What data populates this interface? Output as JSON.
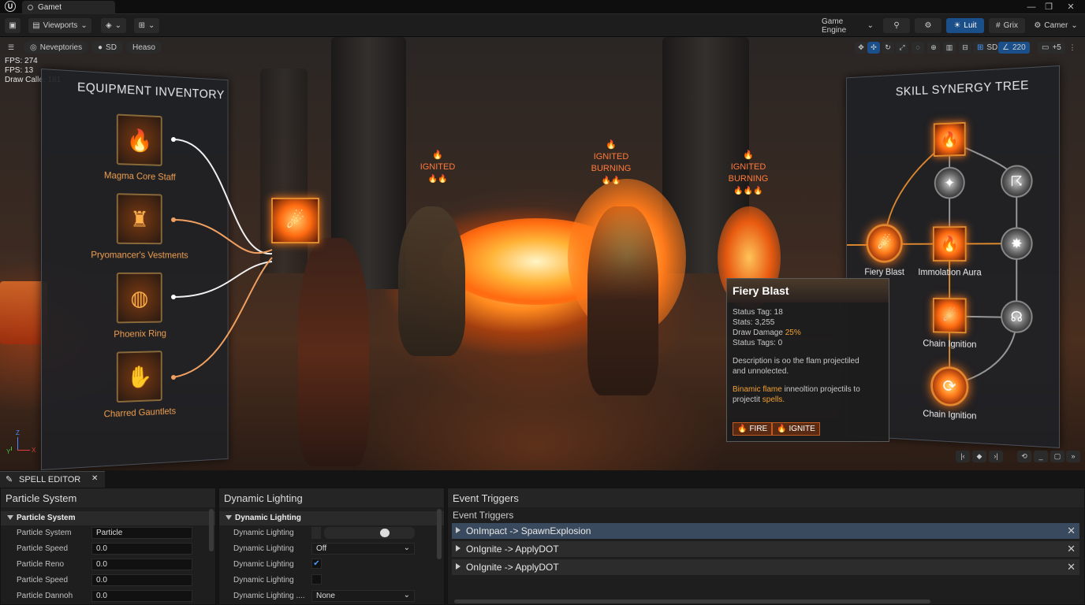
{
  "app": {
    "logo": "U",
    "tab_title": "Gamet",
    "win_min": "—",
    "win_max": "❐",
    "win_close": "✕"
  },
  "toolbar": {
    "viewports_label": "Viewports",
    "game_engine_label": "Game Engine",
    "lit_label": "Luit",
    "grid_label": "Grix",
    "camera_label": "Camer"
  },
  "viewport_bar": {
    "chip1": "Neveptories",
    "chip2": "SD",
    "chip3": "Heaso",
    "sd_right": "SD",
    "num": "220",
    "cam_speed": "+5"
  },
  "stats": {
    "fps1": "FPS: 274",
    "fps2": "FPS: 13",
    "draw_calls": "Draw Calle: 181"
  },
  "inventory": {
    "title": "EQUIPMENT INVENTORY",
    "items": [
      {
        "name": "Magma Core Staff",
        "icon": "staff-icon",
        "glyph": "🔥"
      },
      {
        "name": "Pryomancer's Vestments",
        "icon": "armor-icon",
        "glyph": "♜"
      },
      {
        "name": "Phoenix Ring",
        "icon": "ring-icon",
        "glyph": "◍"
      },
      {
        "name": "Charred Gauntlets",
        "icon": "gauntlet-icon",
        "glyph": "✋"
      }
    ]
  },
  "enemy_tags": [
    {
      "line1": "IGNITED",
      "line2": ""
    },
    {
      "line1": "IGNITED",
      "line2": "BURNING"
    },
    {
      "line1": "IGNITED",
      "line2": "BURNING"
    }
  ],
  "skill_tree": {
    "title": "SKILL SYNERGY TREE",
    "fiery_blast": "Fiery Blast",
    "immolation_aura": "Immolation Aura",
    "chain_ignition_1": "Chain Ignition",
    "chain_ignition_2": "Chain Ignition"
  },
  "tooltip": {
    "title": "Fiery Blast",
    "status_tag": "Status Tag: 18",
    "stats": "Stats: 3,255",
    "draw_damage_label": "Draw Damage",
    "draw_damage_value": "25%",
    "status_tags": "Status Tags: 0",
    "desc1": "Description is oo the flam projectiled",
    "desc2": "and unnolected.",
    "flavor_orange": "Binamic flame",
    "flavor_rest": " inneoltion projectils to",
    "flavor2_rest": "projectit",
    "flavor2_orange": " spells.",
    "chip_fire": "FIRE",
    "chip_ignite": "IGNITE"
  },
  "editor": {
    "tab_label": "SPELL EDITOR",
    "particle": {
      "header": "Particle System",
      "section": "Particle System",
      "rows": [
        {
          "label": "Particle System",
          "value": "Particle"
        },
        {
          "label": "Particle Speed",
          "value": "0.0"
        },
        {
          "label": "Particle Reno",
          "value": "0.0"
        },
        {
          "label": "Particle Speed",
          "value": "0.0"
        },
        {
          "label": "Particle Dannoh",
          "value": "0.0"
        }
      ]
    },
    "lighting": {
      "header": "Dynamic Lighting",
      "section": "Dynamic Lighting",
      "slider_value": 0.7,
      "rows": [
        {
          "label": "Dynamic Lighting"
        },
        {
          "label": "Dynamic Lighting",
          "value": "Off"
        },
        {
          "label": "Dynamic Lighting",
          "checked": true
        },
        {
          "label": "Dynamic Lighting",
          "checked": false
        },
        {
          "label": "Dynamic Lighting ....",
          "value": "None"
        }
      ]
    },
    "events": {
      "header": "Event Triggers",
      "subheader": "Event Triggers",
      "rows": [
        "OnImpact -> SpawnExplosion",
        "OnIgnite -> ApplyDOT",
        "OnIgnite -> ApplyDOT"
      ]
    }
  },
  "colors": {
    "accent": "#1b4f8a",
    "fire": "#ff7a1a",
    "item_text": "#f0a050"
  }
}
